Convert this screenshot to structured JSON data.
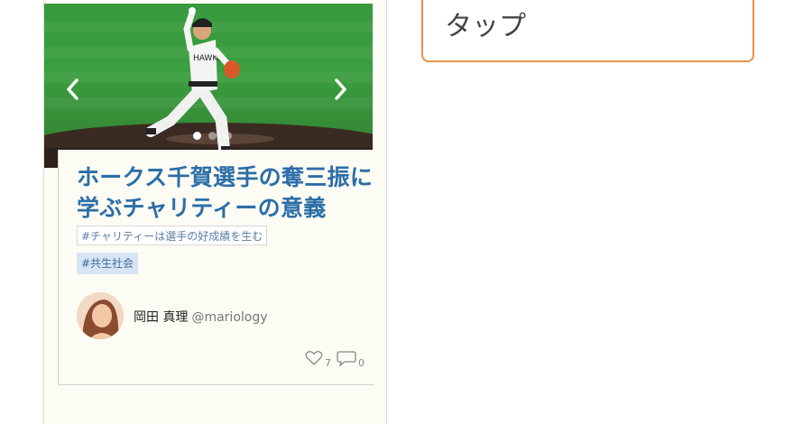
{
  "tap_box": {
    "text": "タップ"
  },
  "carousel": {
    "prev_icon": "chevron-left",
    "next_icon": "chevron-right",
    "slide_count": 3,
    "active_slide": 1
  },
  "article": {
    "title": "ホークス千賀選手の奪三振に学ぶチャリティーの意義",
    "tags": [
      "#チャリティーは選手の好成績を生む",
      "#共生社会"
    ],
    "author": {
      "name": "岡田 真理",
      "handle": "@mariology"
    },
    "likes": "7",
    "comments": "0"
  },
  "colors": {
    "title": "#2b6ea8",
    "tap_border": "#e8914a",
    "tag_fill": "#d7e4f3"
  }
}
